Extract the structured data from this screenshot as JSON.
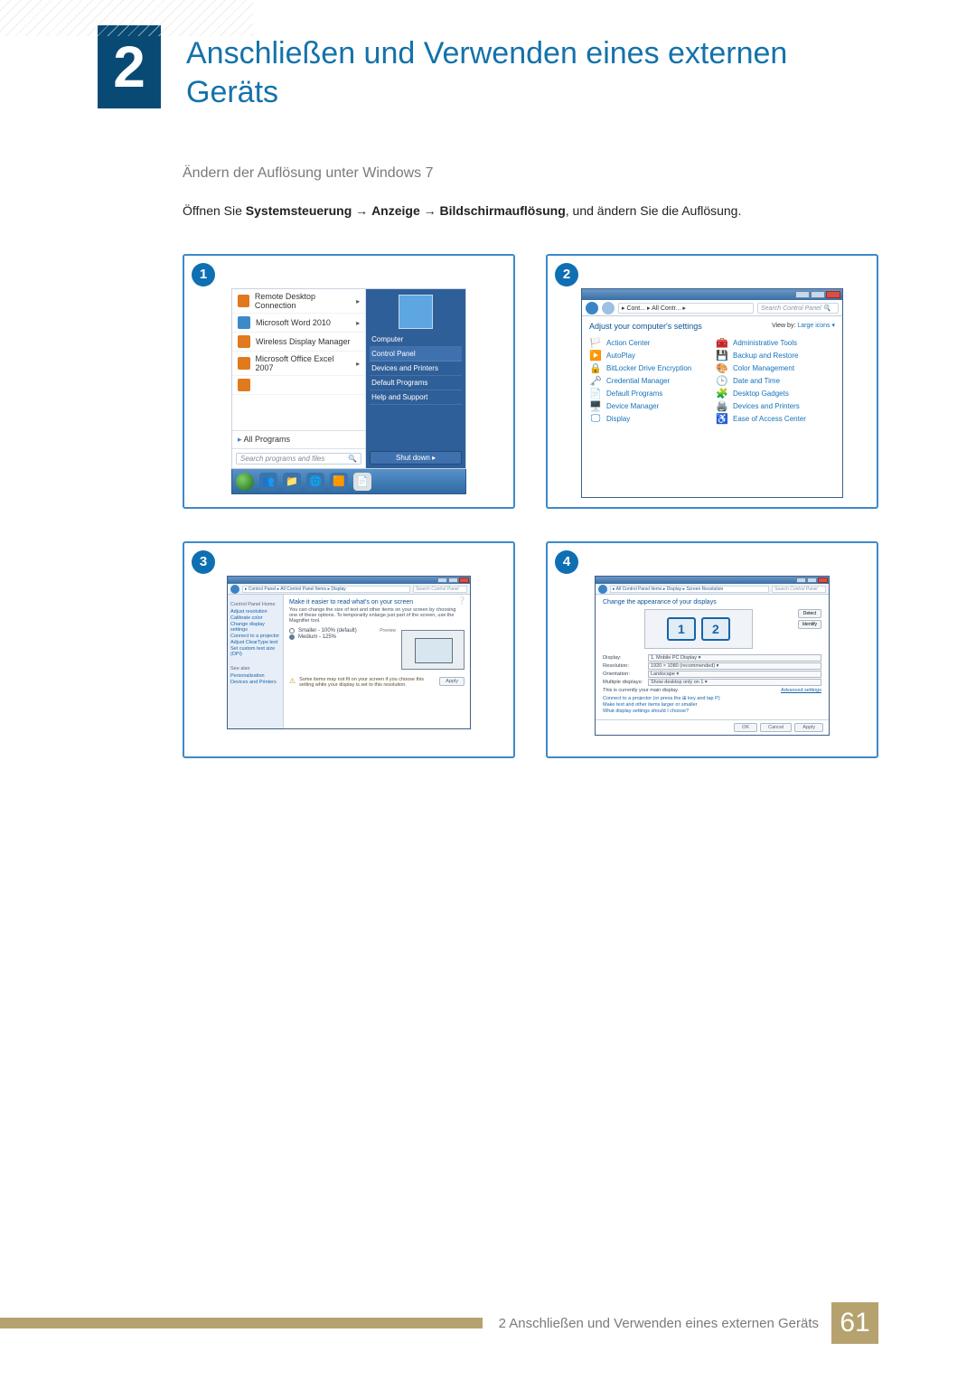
{
  "chapter_number": "2",
  "chapter_title": "Anschließen und Verwenden eines externen Geräts",
  "section_heading": "Ändern der Auflösung unter Windows 7",
  "instruction": {
    "prefix": "Öffnen Sie ",
    "path1": "Systemsteuerung",
    "arrow": " → ",
    "path2": "Anzeige",
    "path3": "Bildschirmauflösung",
    "suffix": ", und ändern Sie die Auflösung."
  },
  "panel1": {
    "number": "1",
    "left_items": [
      "Remote Desktop Connection",
      "Microsoft Word 2010",
      "Wireless Display Manager",
      "Microsoft Office Excel 2007"
    ],
    "all_programs_label": "All Programs",
    "search_placeholder": "Search programs and files",
    "right_items": [
      "Computer",
      "Control Panel",
      "Devices and Printers",
      "Default Programs",
      "Help and Support"
    ],
    "shutdown_label": "Shut down  ▸"
  },
  "panel2": {
    "number": "2",
    "breadcrumb": "▸ Cont... ▸ All Contr... ▸",
    "search_placeholder": "Search Control Panel",
    "adjust_label": "Adjust your computer's settings",
    "viewby_prefix": "View by:  ",
    "viewby_link": "Large icons ▾",
    "items_left": [
      {
        "icon": "🏳️",
        "label": "Action Center"
      },
      {
        "icon": "▶️",
        "label": "AutoPlay"
      },
      {
        "icon": "🔒",
        "label": "BitLocker Drive Encryption"
      },
      {
        "icon": "🗝️",
        "label": "Credential Manager"
      },
      {
        "icon": "📄",
        "label": "Default Programs"
      },
      {
        "icon": "🖥️",
        "label": "Device Manager"
      },
      {
        "icon": "🖵",
        "label": "Display"
      }
    ],
    "items_right": [
      {
        "icon": "🧰",
        "label": "Administrative Tools"
      },
      {
        "icon": "💾",
        "label": "Backup and Restore"
      },
      {
        "icon": "🎨",
        "label": "Color Management"
      },
      {
        "icon": "🕒",
        "label": "Date and Time"
      },
      {
        "icon": "🧩",
        "label": "Desktop Gadgets"
      },
      {
        "icon": "🖨️",
        "label": "Devices and Printers"
      },
      {
        "icon": "♿",
        "label": "Ease of Access Center"
      }
    ]
  },
  "panel3": {
    "number": "3",
    "breadcrumb": "▸ Control Panel ▸ All Control Panel Items ▸ Display",
    "search_placeholder": "Search Control Panel",
    "side_header": "Control Panel Home",
    "side_links": [
      "Adjust resolution",
      "Calibrate color",
      "Change display settings",
      "Connect to a projector",
      "Adjust ClearType text",
      "Set custom text size (DPI)"
    ],
    "see_also": "See also",
    "see_also_links": [
      "Personalization",
      "Devices and Printers"
    ],
    "main_heading": "Make it easier to read what's on your screen",
    "main_hint": "You can change the size of text and other items on your screen by choosing one of these options. To temporarily enlarge just part of the screen, use the Magnifier tool.",
    "radio1": "Smaller - 100% (default)",
    "radio1_note": "Preview",
    "radio2": "Medium - 125%",
    "warning": "Some items may not fit on your screen if you choose this setting while your display is set to this resolution.",
    "apply_label": "Apply"
  },
  "panel4": {
    "number": "4",
    "breadcrumb": "▸ All Control Panel Items ▸ Display ▸ Screen Resolution",
    "search_placeholder": "Search Control Panel",
    "heading": "Change the appearance of your displays",
    "detect_label": "Detect",
    "identify_label": "Identify",
    "rows": {
      "display_label": "Display:",
      "display_value": "1. Mobile PC Display ▾",
      "resolution_label": "Resolution:",
      "resolution_value": "1920 × 1080 (recommended) ▾",
      "orientation_label": "Orientation:",
      "orientation_value": "Landscape ▾",
      "multiple_label": "Multiple displays:",
      "multiple_value": "Show desktop only on 1 ▾"
    },
    "main_text": "This is currently your main display.",
    "advanced_link": "Advanced settings",
    "link1": "Connect to a projector (or press the ⊞ key and tap P)",
    "link2": "Make text and other items larger or smaller",
    "link3": "What display settings should I choose?",
    "ok_label": "OK",
    "cancel_label": "Cancel",
    "apply_label": "Apply"
  },
  "footer": {
    "text": "2 Anschließen und Verwenden eines externen Geräts",
    "page": "61"
  }
}
